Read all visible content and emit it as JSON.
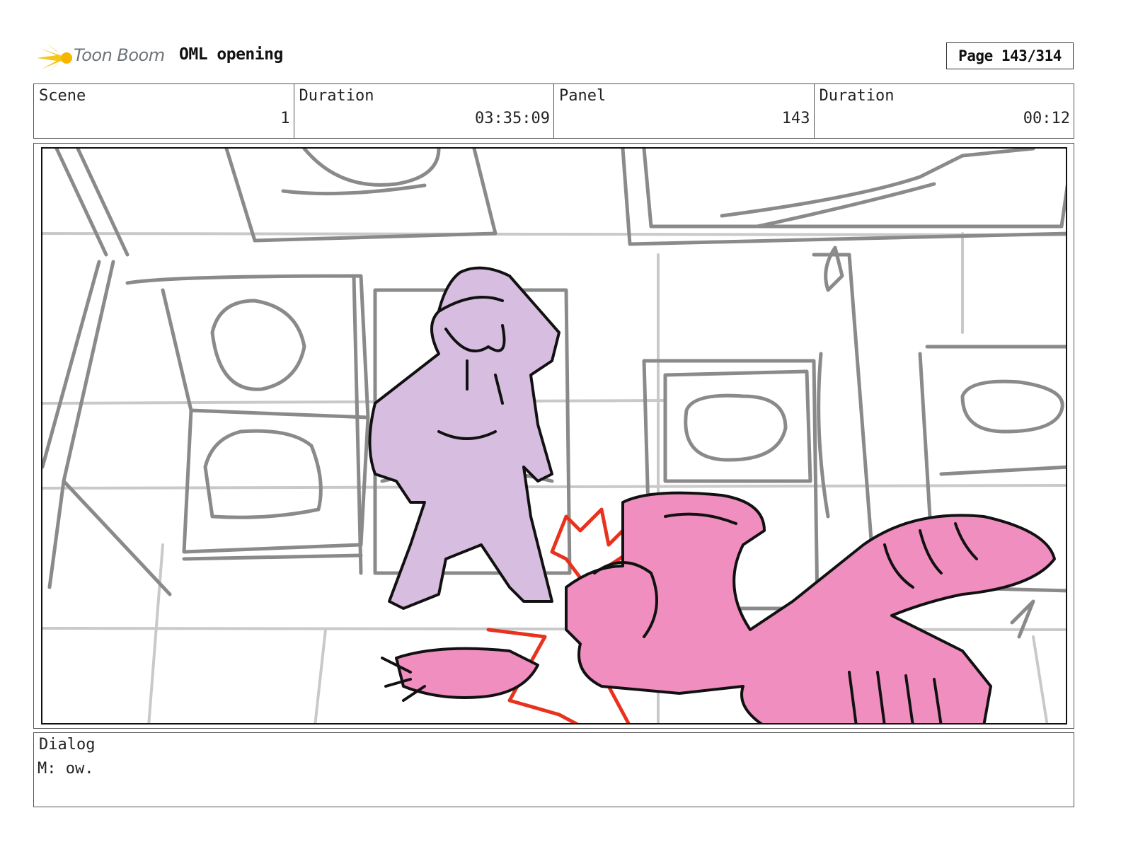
{
  "header": {
    "logo_text": "Toon Boom",
    "title": "OML opening",
    "page": "Page 143/314"
  },
  "info": {
    "scene_label": "Scene",
    "scene_value": "1",
    "duration_label": "Duration",
    "duration_value": "03:35:09",
    "panel_label": "Panel",
    "panel_value": "143",
    "panel_duration_label": "Duration",
    "panel_duration_value": "00:12"
  },
  "dialog": {
    "label": "Dialog",
    "text": "M: ow."
  },
  "colors": {
    "sketch_gray": "#8a8a8a",
    "character_lavender": "#d7bde0",
    "character_pink": "#f08fbf",
    "impact_red": "#e8321e",
    "logo_yellow": "#f5c518"
  }
}
